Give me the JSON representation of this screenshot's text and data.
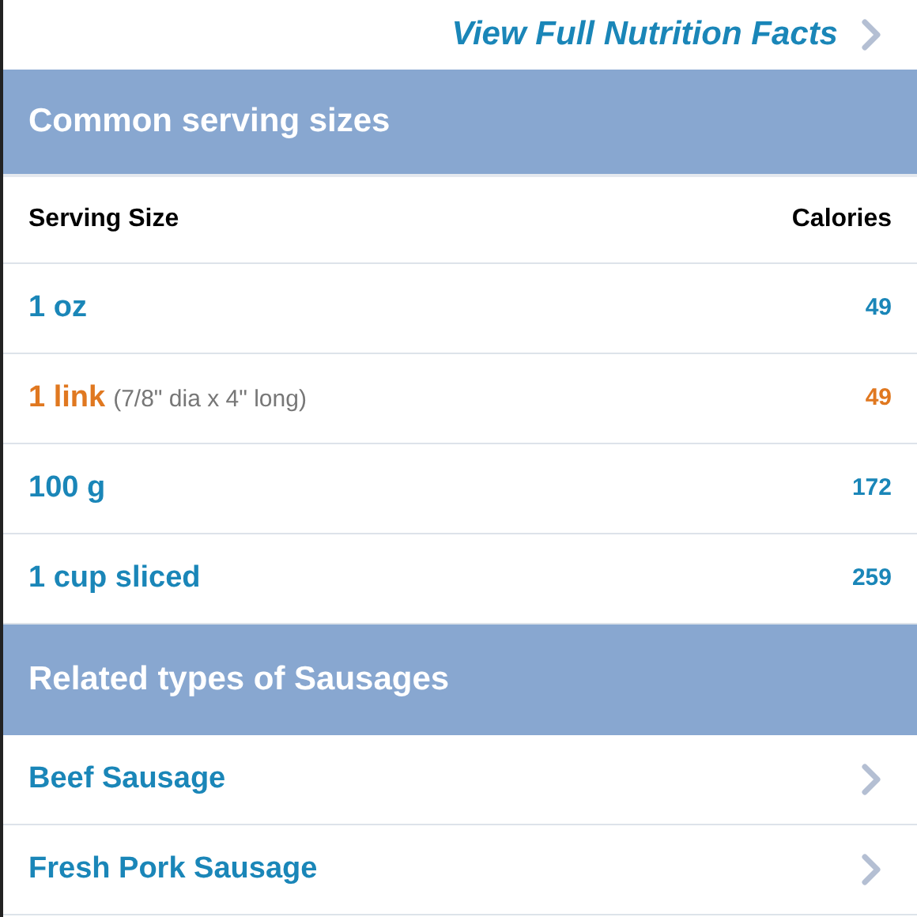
{
  "nutrition_link": {
    "label": "View Full Nutrition Facts"
  },
  "serving_sizes": {
    "title": "Common serving sizes",
    "columns": [
      "Serving Size",
      "Calories"
    ],
    "rows": [
      {
        "size": "1 oz",
        "calories": "49",
        "selected": false
      },
      {
        "size": "1 link",
        "detail": "(7/8\" dia x 4\" long)",
        "calories": "49",
        "selected": true
      },
      {
        "size": "100 g",
        "calories": "172",
        "selected": false
      },
      {
        "size": "1 cup sliced",
        "calories": "259",
        "selected": false
      }
    ]
  },
  "related": {
    "title": "Related types of Sausages",
    "items": [
      {
        "label": "Beef Sausage"
      },
      {
        "label": "Fresh Pork Sausage"
      }
    ]
  }
}
